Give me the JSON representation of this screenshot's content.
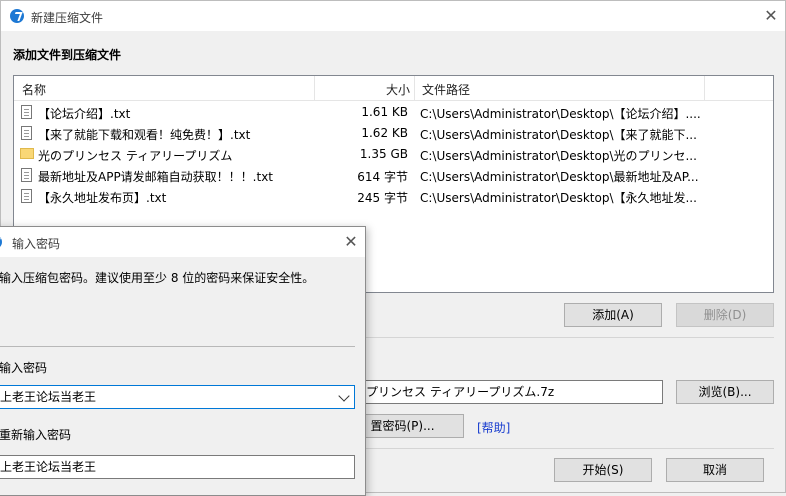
{
  "window": {
    "title": "新建压缩文件",
    "close_icon": "close-icon"
  },
  "section_title": "添加文件到压缩文件",
  "columns": {
    "name": "名称",
    "size": "大小",
    "path": "文件路径"
  },
  "files": [
    {
      "name": "【论坛介绍】.txt",
      "size": "1.61 KB",
      "path": "C:\\Users\\Administrator\\Desktop\\【论坛介绍】....",
      "icon": "text-file-icon"
    },
    {
      "name": "【来了就能下载和观看！纯免费！】.txt",
      "size": "1.62 KB",
      "path": "C:\\Users\\Administrator\\Desktop\\【来了就能下...",
      "icon": "text-file-icon"
    },
    {
      "name": "光のプリンセス ティアリープリズム",
      "size": "1.35 GB",
      "path": "C:\\Users\\Administrator\\Desktop\\光のプリンセ...",
      "icon": "folder-icon"
    },
    {
      "name": "最新地址及APP请发邮箱自动获取！！！.txt",
      "size": "614 字节",
      "path": "C:\\Users\\Administrator\\Desktop\\最新地址及AP...",
      "icon": "text-file-icon"
    },
    {
      "name": "【永久地址发布页】.txt",
      "size": "245 字节",
      "path": "C:\\Users\\Administrator\\Desktop\\【永久地址发...",
      "icon": "text-file-icon"
    }
  ],
  "buttons": {
    "add": "添加(A)",
    "delete": "删除(D)",
    "browse": "浏览(B)...",
    "set_password": "置密码(P)...",
    "help": "[帮助]",
    "start": "开始(S)",
    "cancel": "取消"
  },
  "archive_path": "プリンセス ティアリープリズム.7z",
  "password_dialog": {
    "title": "输入密码",
    "description": "输入压缩包密码。建议使用至少 8 位的密码来保证安全性。",
    "password_label": "输入密码",
    "password_value": "上老王论坛当老王",
    "confirm_label": "重新输入密码",
    "confirm_value": "上老王论坛当老王"
  }
}
